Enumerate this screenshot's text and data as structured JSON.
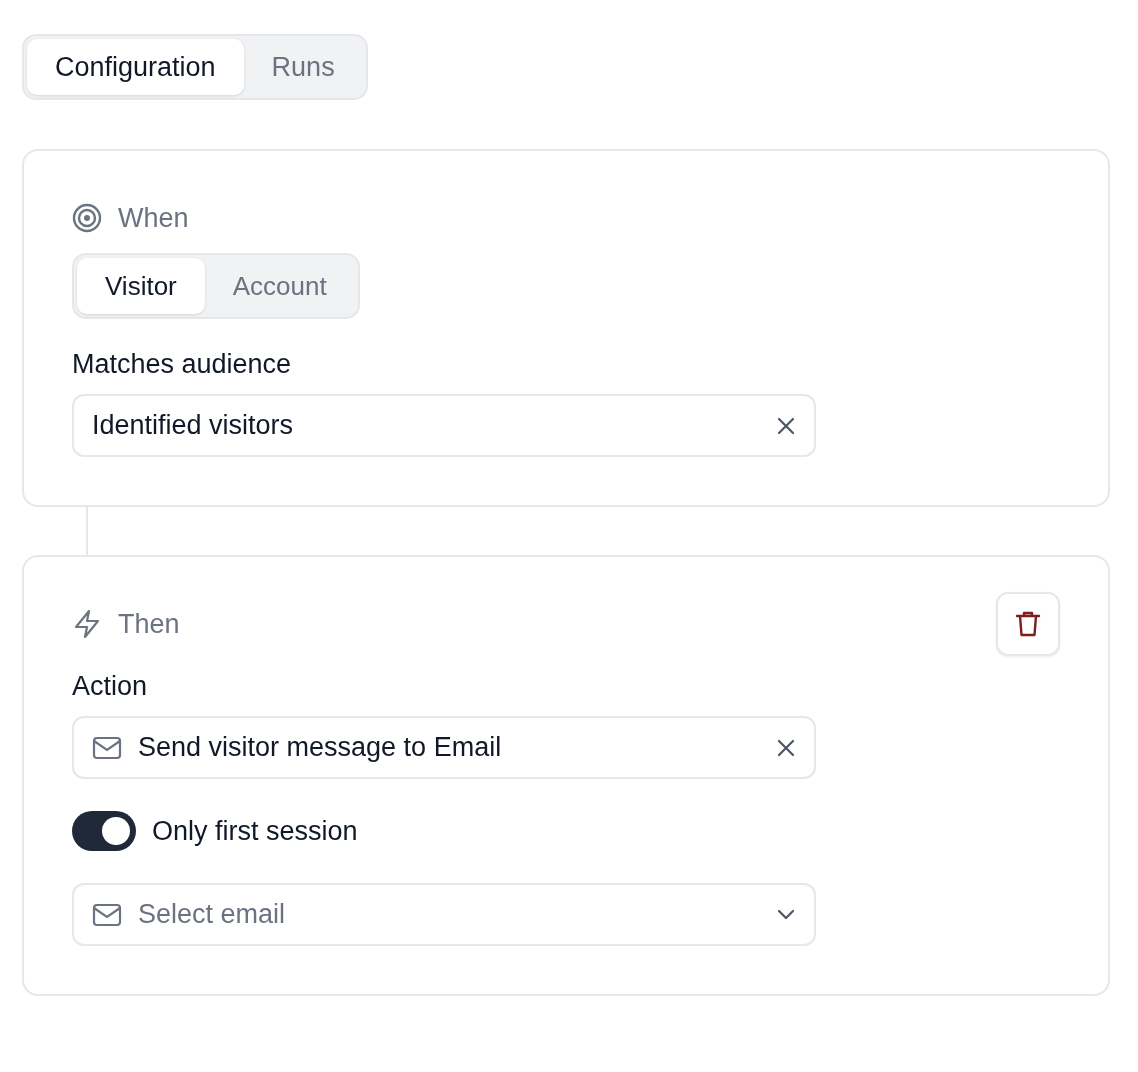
{
  "tabs": [
    {
      "label": "Configuration",
      "selected": true
    },
    {
      "label": "Runs",
      "selected": false
    }
  ],
  "when": {
    "title": "When",
    "audience_tabs": [
      {
        "label": "Visitor",
        "selected": true
      },
      {
        "label": "Account",
        "selected": false
      }
    ],
    "field_label": "Matches audience",
    "field_value": "Identified visitors"
  },
  "then": {
    "title": "Then",
    "field_label": "Action",
    "action_value": "Send visitor message to Email",
    "toggle": {
      "label": "Only first session",
      "on": true
    },
    "email_select": {
      "placeholder": "Select email"
    }
  }
}
